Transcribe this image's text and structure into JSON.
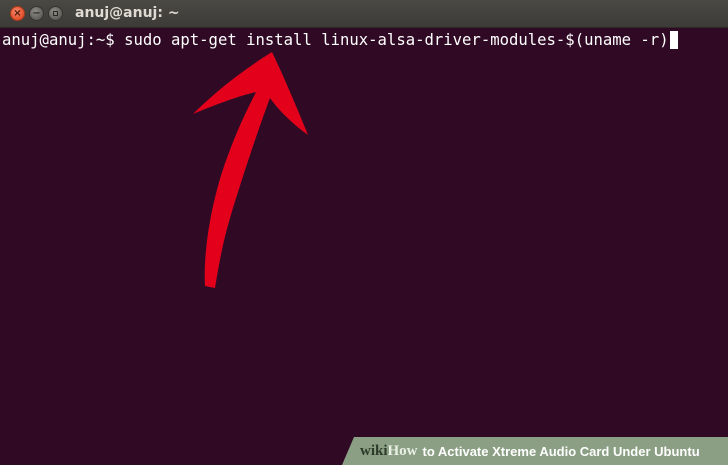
{
  "window": {
    "title": "anuj@anuj: ~",
    "controls": [
      {
        "name": "close",
        "glyph": "×"
      },
      {
        "name": "minimize",
        "glyph": "−"
      },
      {
        "name": "maximize",
        "glyph": ""
      }
    ]
  },
  "terminal": {
    "prompt": "anuj@anuj:~$ ",
    "command": "sudo apt-get install linux-alsa-driver-modules-$(uname -r)",
    "background_color": "#300a24",
    "text_color": "#ffffff"
  },
  "annotation": {
    "icon": "red-arrow-icon",
    "color": "#e3001b"
  },
  "watermark": {
    "logo_prefix": "wiki",
    "logo_suffix": "How",
    "text": "to Activate Xtreme Audio Card Under Ubuntu"
  }
}
